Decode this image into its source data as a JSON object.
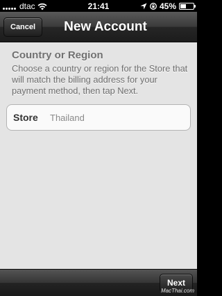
{
  "status_bar": {
    "carrier": "dtac",
    "time": "21:41",
    "battery": "45%",
    "battery_level": 0.45
  },
  "nav": {
    "cancel_label": "Cancel",
    "title": "New Account"
  },
  "section": {
    "title": "Country or Region",
    "description": "Choose a country or region for the Store that will match the billing address for your payment method, then tap Next."
  },
  "store_field": {
    "label": "Store",
    "value": "Thailand"
  },
  "toolbar": {
    "next_label": "Next",
    "watermark": "MacThai.com"
  }
}
